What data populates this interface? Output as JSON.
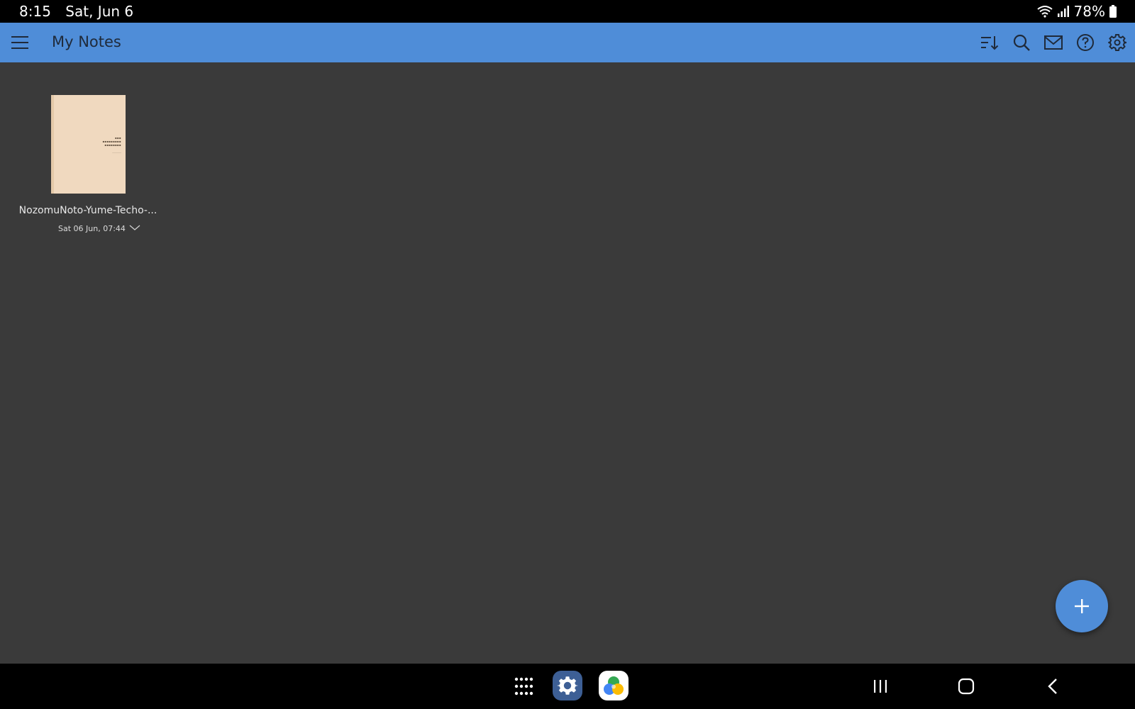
{
  "status_bar": {
    "time": "8:15",
    "date": "Sat, Jun 6",
    "battery": "78%",
    "icons": [
      "wifi-icon",
      "signal-icon",
      "battery-icon"
    ]
  },
  "app_bar": {
    "title": "My Notes",
    "color": "#4f8dd8",
    "actions": [
      "sort-icon",
      "search-icon",
      "mail-icon",
      "help-icon",
      "gear-icon"
    ]
  },
  "notes": [
    {
      "name": "NozomuNoto-Yume-Techo-...",
      "date": "Sat 06 Jun, 07:44"
    }
  ],
  "fab": {
    "icon": "plus-icon",
    "color": "#4f8dd8"
  },
  "nav_bar": {
    "dock_apps": [
      "settings-app",
      "drive-app"
    ],
    "buttons": [
      "recents-icon",
      "home-icon",
      "back-icon"
    ]
  }
}
